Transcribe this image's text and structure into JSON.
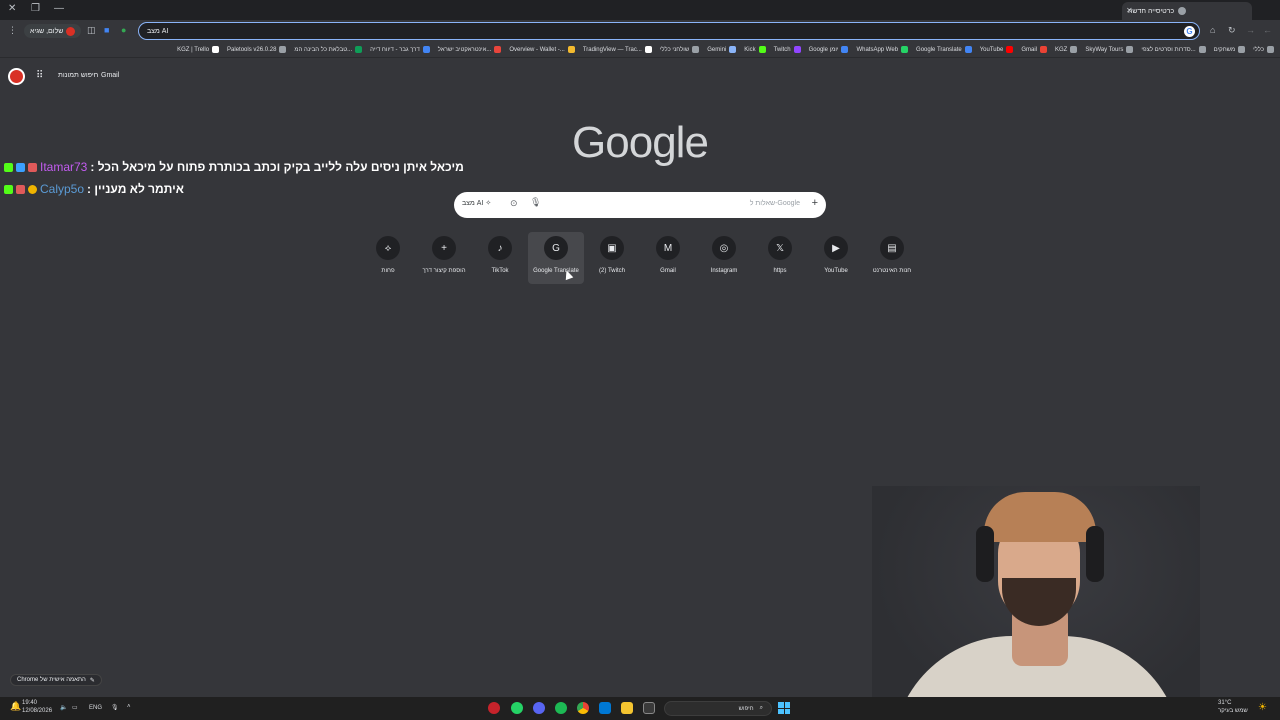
{
  "tab": {
    "title": "כרטיסייה חדשה"
  },
  "toolbar": {
    "omnibox_text": "מצב AI",
    "profile_label": "שלום, שגיא"
  },
  "bookmarks": [
    {
      "label": "כללי",
      "color": "#9aa0a6"
    },
    {
      "label": "משחקים",
      "color": "#9aa0a6"
    },
    {
      "label": "סדרות וסרטים לצפי...",
      "color": "#9aa0a6"
    },
    {
      "label": "SkyWay Tours",
      "color": "#9aa0a6"
    },
    {
      "label": "KGZ",
      "color": "#9aa0a6"
    },
    {
      "label": "Gmail",
      "color": "#ea4335"
    },
    {
      "label": "YouTube",
      "color": "#ff0000"
    },
    {
      "label": "Google Translate",
      "color": "#4285f4"
    },
    {
      "label": "WhatsApp Web",
      "color": "#25d366"
    },
    {
      "label": "Google יומן",
      "color": "#4285f4"
    },
    {
      "label": "Twitch",
      "color": "#9146ff"
    },
    {
      "label": "Kick",
      "color": "#53fc18"
    },
    {
      "label": "Gemini",
      "color": "#8ab4f8"
    },
    {
      "label": "שולחני כללי",
      "color": "#9aa0a6"
    },
    {
      "label": "TradingView — Trac...",
      "color": "#ffffff"
    },
    {
      "label": "Overview - Wallet -...",
      "color": "#f3ba2f"
    },
    {
      "label": "אינטראקטיב ישראל...",
      "color": "#e8453c"
    },
    {
      "label": "דרך גבר - דיווח דייה",
      "color": "#4285f4"
    },
    {
      "label": "טבלאת כל הבינה המ...",
      "color": "#0f9d58"
    },
    {
      "label": "Paletools v26.0.28",
      "color": "#9aa0a6"
    },
    {
      "label": "KGZ | Trello",
      "color": "#ffffff"
    }
  ],
  "ntp": {
    "top_links": {
      "gmail": "Gmail",
      "images": "חיפוש תמונות"
    },
    "logo": "Google",
    "search": {
      "ai_mode": "מצב AI",
      "placeholder": "שאלות ל-Google"
    },
    "shortcuts": [
      {
        "label": "פחות",
        "icon": "collapse-icon",
        "glyph": "⟡"
      },
      {
        "label": "הוספת קיצור דרך",
        "icon": "plus-icon",
        "glyph": "+"
      },
      {
        "label": "TikTok",
        "icon": "tiktok-icon",
        "glyph": "♪"
      },
      {
        "label": "Google Translate",
        "icon": "translate-icon",
        "glyph": "G"
      },
      {
        "label": "(2) Twitch",
        "icon": "twitch-icon",
        "glyph": "▣"
      },
      {
        "label": "Gmail",
        "icon": "gmail-icon",
        "glyph": "M"
      },
      {
        "label": "Instagram",
        "icon": "instagram-icon",
        "glyph": "◎"
      },
      {
        "label": "https",
        "icon": "x-icon",
        "glyph": "𝕏"
      },
      {
        "label": "YouTube",
        "icon": "youtube-icon",
        "glyph": "▶"
      },
      {
        "label": "חנות האינטרנט",
        "icon": "webstore-icon",
        "glyph": "▤"
      }
    ],
    "customize_label": "Chrome התאמה אישית של"
  },
  "chat": [
    {
      "user": "Itamar73",
      "message": ": מיכאל איתן ניסים עלה ללייב בקיק וכתב בכותרת פתוח על מיכאל הכל"
    },
    {
      "user": "Calyp5o",
      "message": ": איתמר לא מעניין"
    }
  ],
  "taskbar": {
    "time": "19:40",
    "date": "12/08/2026",
    "lang": "ENG",
    "search_placeholder": "חיפוש",
    "weather_temp": "31°C",
    "weather_desc": "שמש בעיקר"
  }
}
